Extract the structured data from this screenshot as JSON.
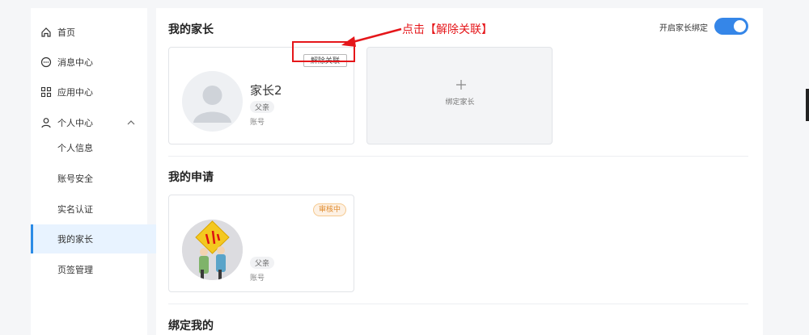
{
  "sidebar": {
    "items": [
      {
        "label": "首页",
        "icon": "home-icon"
      },
      {
        "label": "消息中心",
        "icon": "message-icon"
      },
      {
        "label": "应用中心",
        "icon": "grid-icon"
      },
      {
        "label": "个人中心",
        "icon": "user-icon",
        "expanded": true
      }
    ],
    "subitems": [
      {
        "label": "个人信息"
      },
      {
        "label": "账号安全"
      },
      {
        "label": "实名认证"
      },
      {
        "label": "我的家长",
        "active": true
      },
      {
        "label": "页签管理"
      }
    ]
  },
  "sections": {
    "my_parents": "我的家长",
    "my_requests": "我的申请",
    "bound_me": "绑定我的"
  },
  "parent_card": {
    "name": "家长2",
    "role": "父亲",
    "account_label": "账号",
    "unbind_label": "解除关联"
  },
  "bind_card": {
    "label": "绑定家长"
  },
  "request_card": {
    "role": "父亲",
    "account_label": "账号",
    "status": "审核中"
  },
  "annotation": {
    "text": "点击【解除关联】"
  },
  "toggle": {
    "label": "开启家长绑定",
    "on": true
  },
  "colors": {
    "accent": "#3586e8",
    "annotation_red": "#e5161a",
    "pending_orange": "#e08a2b"
  }
}
